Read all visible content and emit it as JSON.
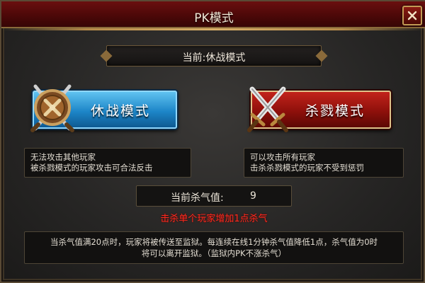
{
  "window": {
    "title": "PK模式",
    "close_icon": "close-icon"
  },
  "current_mode": {
    "label": "当前:休战模式"
  },
  "modes": {
    "truce": {
      "label": "休战模式",
      "icon": "shield-swords-icon",
      "color": "#1d86c8",
      "desc_line1": "无法攻击其他玩家",
      "desc_line2": "被杀戮模式的玩家攻击可合法反击"
    },
    "slaughter": {
      "label": "杀戮模式",
      "icon": "crossed-swords-icon",
      "color": "#8e100b",
      "desc_line1": "可以攻击所有玩家",
      "desc_line2": "击杀杀戮模式的玩家不受到惩罚"
    }
  },
  "kill_value": {
    "label": "当前杀气值:",
    "value": "9"
  },
  "warning": "击杀单个玩家增加1点杀气",
  "rules": {
    "line1": "当杀气值满20点时，玩家将被传送至监狱。每连续在线1分钟杀气值降低1点，杀气值为0时",
    "line2": "将可以离开监狱。（监狱内PK不涨杀气）"
  }
}
